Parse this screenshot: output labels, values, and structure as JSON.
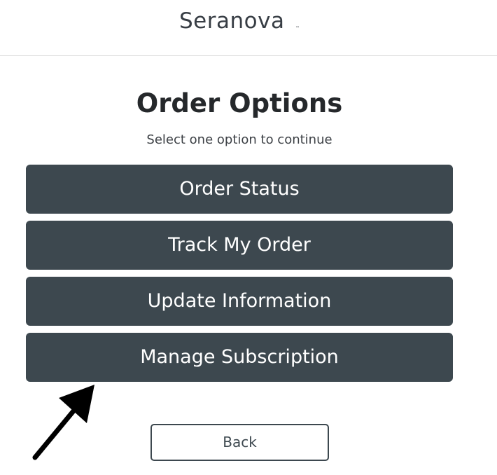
{
  "header": {
    "logo_text": "Seranova",
    "logo_tm": "™"
  },
  "main": {
    "title": "Order Options",
    "subtitle": "Select one option to continue",
    "options": [
      {
        "label": "Order Status"
      },
      {
        "label": "Track My Order"
      },
      {
        "label": "Update Information"
      },
      {
        "label": "Manage Subscription"
      }
    ],
    "back_label": "Back"
  },
  "colors": {
    "button_bg": "#3d484f",
    "title_text": "#25282b",
    "annotation_arrow": "#000000"
  },
  "annotation": {
    "icon": "arrow-up-right-icon"
  }
}
